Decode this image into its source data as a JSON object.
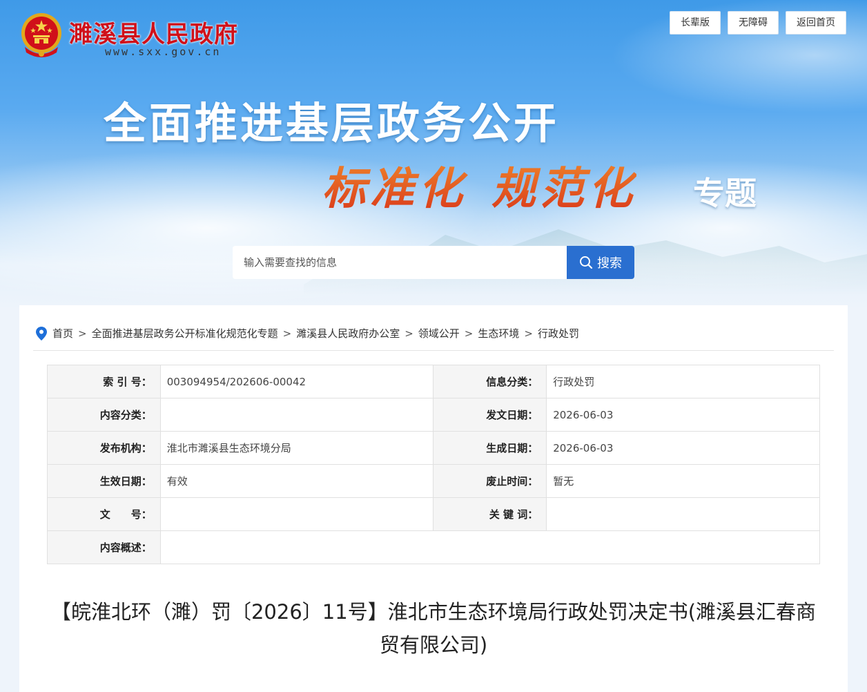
{
  "header": {
    "site_name": "濉溪县人民政府",
    "site_url": "www.sxx.gov.cn",
    "links": [
      {
        "label": "长辈版"
      },
      {
        "label": "无障碍"
      },
      {
        "label": "返回首页"
      }
    ]
  },
  "banner": {
    "headline": "全面推进基层政务公开",
    "slogan_1": "标准化",
    "slogan_2": "规范化",
    "slogan_suffix": "专题"
  },
  "search": {
    "placeholder": "输入需要查找的信息",
    "button_label": "搜索"
  },
  "breadcrumb": {
    "items": [
      "首页",
      "全面推进基层政务公开标准化规范化专题",
      "濉溪县人民政府办公室",
      "领域公开",
      "生态环境",
      "行政处罚"
    ],
    "separator": ">"
  },
  "meta": {
    "index_no_label": "索 引 号：",
    "index_no": "003094954/202606-00042",
    "info_category_label": "信息分类：",
    "info_category": "行政处罚",
    "content_category_label": "内容分类：",
    "content_category": "",
    "issue_date_label": "发文日期：",
    "issue_date": "2026-06-03",
    "publisher_label": "发布机构：",
    "publisher": "淮北市濉溪县生态环境分局",
    "generated_date_label": "生成日期：",
    "generated_date": "2026-06-03",
    "effective_label": "生效日期：",
    "effective": "有效",
    "repeal_label": "废止时间：",
    "repeal": "暂无",
    "doc_no_label": "文　　号：",
    "doc_no": "",
    "keywords_label": "关 键 词：",
    "keywords": "",
    "summary_label": "内容概述：",
    "summary": ""
  },
  "document": {
    "title": "【皖淮北环（濉）罚〔2026〕11号】淮北市生态环境局行政处罚决定书(濉溪县汇春商贸有限公司)"
  },
  "colors": {
    "brand_red": "#d0101a",
    "search_button": "#2a6fd0",
    "slogan_orange": "#e9531d",
    "location_pin": "#1e6fd9"
  },
  "icons": {
    "emblem": "national-emblem-icon",
    "search": "search-icon",
    "location": "location-pin-icon"
  }
}
